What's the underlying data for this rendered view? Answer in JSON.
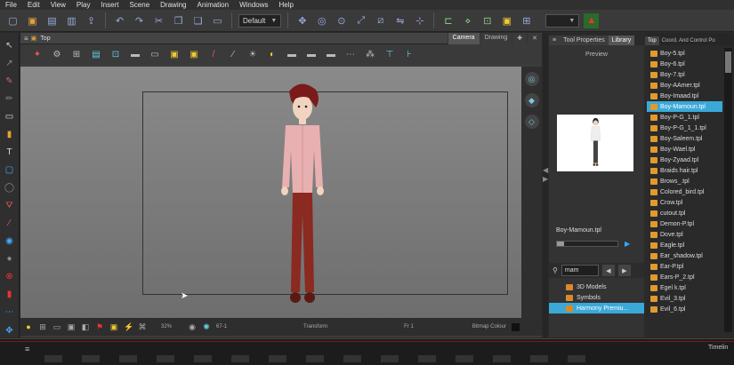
{
  "menu": [
    "File",
    "Edit",
    "View",
    "Play",
    "Insert",
    "Scene",
    "Drawing",
    "Animation",
    "Windows",
    "Help"
  ],
  "toolbar": {
    "workspace_select": "Default"
  },
  "camera_view": {
    "title": "Top",
    "tabs": [
      "Camera",
      "Drawing"
    ],
    "status": {
      "zoom": "32%",
      "frame_rotation": "67-1",
      "mode": "Transform",
      "frame": "Fr 1",
      "bitmap": "Bitmap Colour"
    }
  },
  "tool_properties": {
    "tabs": [
      "Tool Properties",
      "Library"
    ],
    "preview_label": "Preview",
    "template_name": "Boy-Mamoun.tpl",
    "search_value": "mam",
    "tree": [
      {
        "label": "3D Models",
        "selected": false
      },
      {
        "label": "Symbols",
        "selected": false
      },
      {
        "label": "Harmony Premiu...",
        "selected": true
      }
    ]
  },
  "library_panel": {
    "tabs": [
      "Top",
      "Coord. And Control Po"
    ],
    "files": [
      {
        "label": "Boy-5.tpl",
        "selected": false
      },
      {
        "label": "Boy-6.tpl",
        "selected": false
      },
      {
        "label": "Boy-7.tpl",
        "selected": false
      },
      {
        "label": "Boy-AAmer.tpl",
        "selected": false
      },
      {
        "label": "Boy-Imaad.tpl",
        "selected": false
      },
      {
        "label": "Boy-Mamoun.tpl",
        "selected": true
      },
      {
        "label": "Boy-P-G_1.tpl",
        "selected": false
      },
      {
        "label": "Boy-P-G_1_1.tpl",
        "selected": false
      },
      {
        "label": "Boy-Saleem.tpl",
        "selected": false
      },
      {
        "label": "Boy-Wael.tpl",
        "selected": false
      },
      {
        "label": "Boy-Zyaad.tpl",
        "selected": false
      },
      {
        "label": "Braids hair.tpl",
        "selected": false
      },
      {
        "label": "Brows_.tpl",
        "selected": false
      },
      {
        "label": "Colored_bird.tpl",
        "selected": false
      },
      {
        "label": "Crow.tpl",
        "selected": false
      },
      {
        "label": "cutout.tpl",
        "selected": false
      },
      {
        "label": "Demon-P.tpl",
        "selected": false
      },
      {
        "label": "Dove.tpl",
        "selected": false
      },
      {
        "label": "Eagle.tpl",
        "selected": false
      },
      {
        "label": "Ear_shadow.tpl",
        "selected": false
      },
      {
        "label": "Ear-P.tpl",
        "selected": false
      },
      {
        "label": "Ears-P_2.tpl",
        "selected": false
      },
      {
        "label": "Egel k.tpl",
        "selected": false
      },
      {
        "label": "Evil_3.tpl",
        "selected": false
      },
      {
        "label": "Evil_6.tpl",
        "selected": false
      }
    ]
  },
  "timeline": {
    "label": "Timelin"
  },
  "colors": {
    "selection": "#3aa9d8",
    "folder": "#e09a30",
    "shirt": "#e8b0b0",
    "pants": "#8a2a20",
    "hair": "#7a1a1a"
  }
}
